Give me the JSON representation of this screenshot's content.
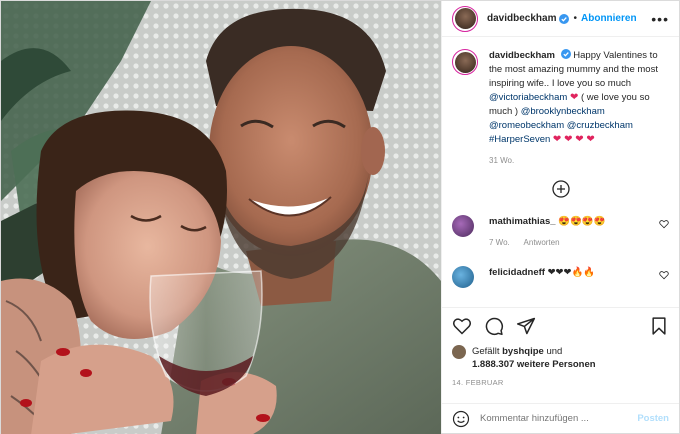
{
  "header": {
    "username": "davidbeckham",
    "separator": "•",
    "follow_label": "Abonnieren",
    "more_label": "•••"
  },
  "caption": {
    "username": "davidbeckham",
    "text_1": "Happy Valentines to the most amazing mummy and the most inspiring wife.. I love you so much",
    "mention_victoria": "@victoriabeckham",
    "text_2": "( we love you so much )",
    "mention_brooklyn": "@brooklynbeckham",
    "mention_romeo": "@romeobeckham",
    "mention_cruz": "@cruzbeckham",
    "hashtag": "#HarperSeven",
    "hearts": "❤ ❤ ❤ ❤",
    "heart_single": "❤",
    "age": "31 Wo."
  },
  "comments": [
    {
      "username": "mathimathias_",
      "text": "😍😍😍😍",
      "age": "7 Wo.",
      "reply_label": "Antworten",
      "avatar_color": "#6b3c84"
    },
    {
      "username": "felicidadneff",
      "text": "❤❤❤🔥🔥",
      "avatar_color": "#3a8fc7"
    }
  ],
  "likes": {
    "prefix": "Gefällt",
    "user": "byshqipe",
    "and": "und",
    "count": "1.888.307 weitere Personen"
  },
  "date": "14. Februar",
  "add_comment": {
    "placeholder": "Kommentar hinzufügen ...",
    "post_label": "Posten"
  },
  "colors": {
    "accent": "#0095f6",
    "link": "#00376b",
    "heart": "#e0245e",
    "muted": "#8e8e8e"
  }
}
